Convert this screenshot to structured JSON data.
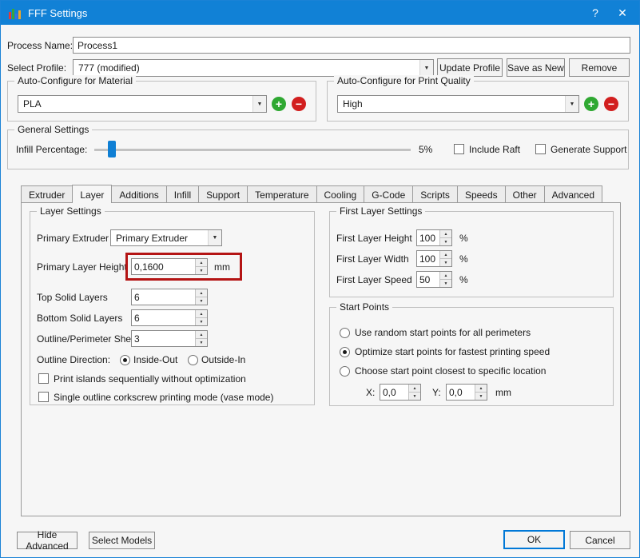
{
  "window": {
    "title": "FFF Settings"
  },
  "icons": {
    "help": "?",
    "close": "✕",
    "dropdown_arrow": "▼",
    "spin_up": "▲",
    "spin_down": "▼",
    "add": "+",
    "remove": "−"
  },
  "colors": {
    "titlebar_blue": "#1181d6",
    "accent_blue": "#0078d7",
    "highlight_red": "#b41414",
    "add_green": "#2fa832",
    "delete_red": "#d21f1f"
  },
  "header": {
    "process_name_label": "Process Name:",
    "process_name_value": "Process1",
    "select_profile_label": "Select Profile:",
    "profile_value": "777 (modified)",
    "update_profile_button": "Update Profile",
    "save_as_new_button": "Save as New",
    "remove_button": "Remove"
  },
  "auto_configure": {
    "material_title": "Auto-Configure for Material",
    "material_value": "PLA",
    "quality_title": "Auto-Configure for Print Quality",
    "quality_value": "High"
  },
  "general": {
    "title": "General Settings",
    "infill_label": "Infill Percentage:",
    "infill_value": "5%",
    "include_raft_label": "Include Raft",
    "include_raft_checked": false,
    "generate_support_label": "Generate Support",
    "generate_support_checked": false
  },
  "tabs": [
    {
      "label": "Extruder"
    },
    {
      "label": "Layer"
    },
    {
      "label": "Additions"
    },
    {
      "label": "Infill"
    },
    {
      "label": "Support"
    },
    {
      "label": "Temperature"
    },
    {
      "label": "Cooling"
    },
    {
      "label": "G-Code"
    },
    {
      "label": "Scripts"
    },
    {
      "label": "Speeds"
    },
    {
      "label": "Other"
    },
    {
      "label": "Advanced"
    }
  ],
  "active_tab": "Layer",
  "layer_settings": {
    "title": "Layer Settings",
    "primary_extruder_label": "Primary Extruder",
    "primary_extruder_value": "Primary Extruder",
    "primary_layer_height_label": "Primary Layer Height",
    "primary_layer_height_value": "0,1600",
    "primary_layer_height_unit": "mm",
    "top_solid_layers_label": "Top Solid Layers",
    "top_solid_layers_value": "6",
    "bottom_solid_layers_label": "Bottom Solid Layers",
    "bottom_solid_layers_value": "6",
    "outline_shells_label": "Outline/Perimeter Shells",
    "outline_shells_value": "3",
    "outline_direction_label": "Outline Direction:",
    "outline_direction_options": [
      {
        "label": "Inside-Out",
        "selected": true
      },
      {
        "label": "Outside-In",
        "selected": false
      }
    ],
    "print_islands_label": "Print islands sequentially without optimization",
    "print_islands_checked": false,
    "vase_mode_label": "Single outline corkscrew printing mode (vase mode)",
    "vase_mode_checked": false
  },
  "first_layer_settings": {
    "title": "First Layer Settings",
    "height_label": "First Layer Height",
    "height_value": "100",
    "height_unit": "%",
    "width_label": "First Layer Width",
    "width_value": "100",
    "width_unit": "%",
    "speed_label": "First Layer Speed",
    "speed_value": "50",
    "speed_unit": "%"
  },
  "start_points": {
    "title": "Start Points",
    "options": [
      {
        "label": "Use random start points for all perimeters",
        "selected": false
      },
      {
        "label": "Optimize start points for fastest printing speed",
        "selected": true
      },
      {
        "label": "Choose start point closest to specific location",
        "selected": false
      }
    ],
    "x_label": "X:",
    "x_value": "0,0",
    "y_label": "Y:",
    "y_value": "0,0",
    "unit": "mm"
  },
  "footer": {
    "hide_advanced_button": "Hide Advanced",
    "select_models_button": "Select Models",
    "ok_button": "OK",
    "cancel_button": "Cancel"
  }
}
